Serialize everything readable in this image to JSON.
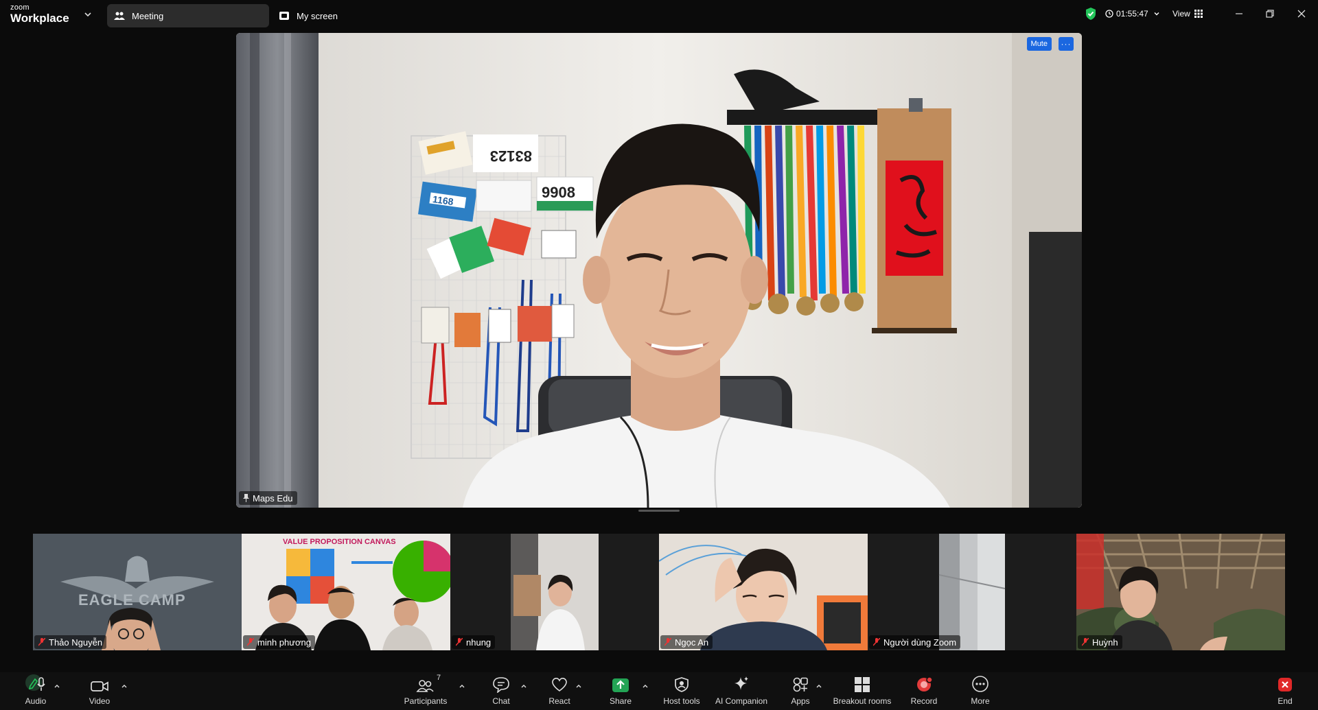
{
  "app": {
    "brand_small": "zoom",
    "brand_big": "Workplace"
  },
  "tabs": [
    {
      "label": "Meeting",
      "active": true
    },
    {
      "label": "My screen",
      "active": false
    }
  ],
  "topbar": {
    "timer": "01:55:47",
    "view_label": "View"
  },
  "main_video": {
    "participant": "Maps Edu",
    "mute_label": "Mute",
    "more_label": "···"
  },
  "gallery": [
    {
      "name": "Thảo Nguyễn",
      "muted": true
    },
    {
      "name": "minh phương",
      "muted": true
    },
    {
      "name": "nhung",
      "muted": true
    },
    {
      "name": "Ngọc An",
      "muted": true
    },
    {
      "name": "Người dùng Zoom",
      "muted": true
    },
    {
      "name": "Huỳnh",
      "muted": true
    }
  ],
  "tile_texts": {
    "eagle": "EAGLE CAMP",
    "canvas": "VALUE PROPOSITION CANVAS",
    "bib1": "83123",
    "bib2": "9908",
    "bib3": "1168"
  },
  "toolbar": {
    "audio": "Audio",
    "video": "Video",
    "participants": "Participants",
    "participants_count": "7",
    "chat": "Chat",
    "react": "React",
    "share": "Share",
    "host_tools": "Host tools",
    "ai_companion": "AI Companion",
    "apps": "Apps",
    "breakout": "Breakout rooms",
    "record": "Record",
    "more": "More",
    "end": "End"
  },
  "colors": {
    "accent": "#1b67e0",
    "share_green": "#23a455",
    "record_red": "#e23b3b",
    "end_red": "#e02828",
    "shield_green": "#23c45a"
  }
}
